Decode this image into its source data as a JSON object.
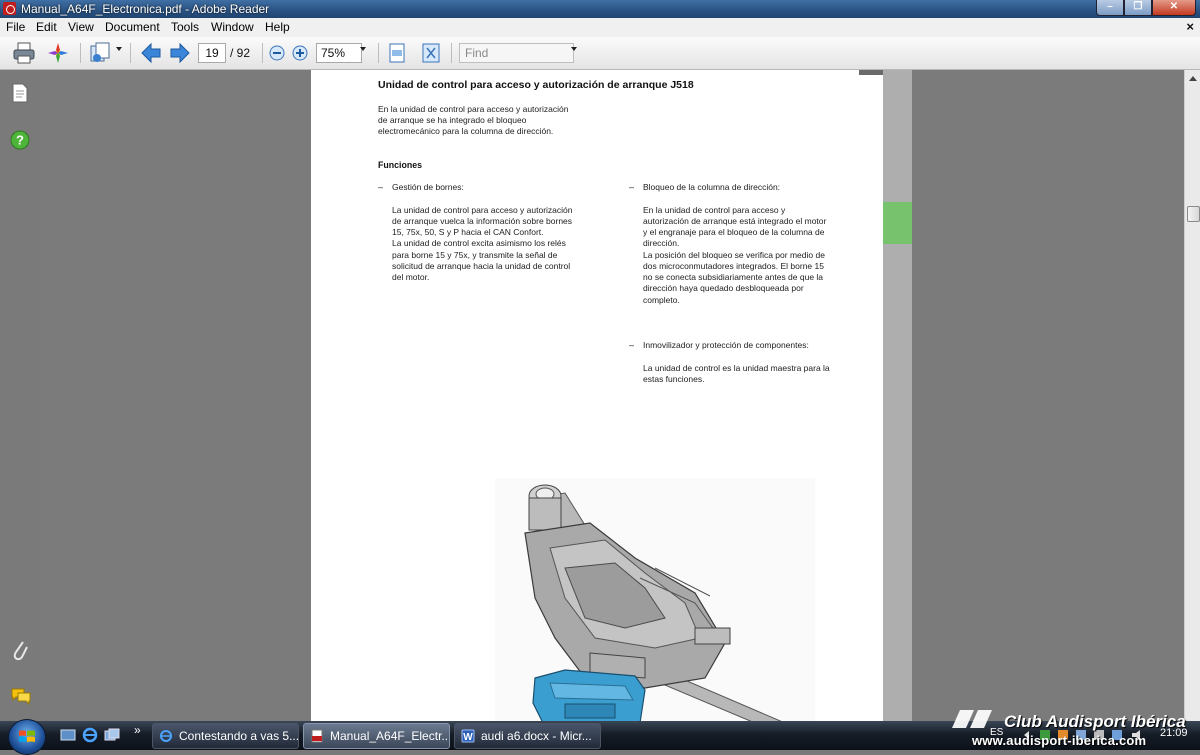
{
  "window": {
    "title": "Manual_A64F_Electronica.pdf - Adobe Reader",
    "close_doc_glyph": "×"
  },
  "menu": [
    "File",
    "Edit",
    "View",
    "Document",
    "Tools",
    "Window",
    "Help"
  ],
  "toolbar": {
    "current_page": "19",
    "total_pages": "/ 92",
    "zoom": "75%",
    "find_placeholder": "Find"
  },
  "document": {
    "heading": "Unidad de control para acceso y autorización de arranque J518",
    "intro": [
      "En la unidad de control para acceso y autorización",
      "de arranque se ha integrado el bloqueo",
      "electromecánico para la columna de dirección."
    ],
    "funciones_title": "Funciones",
    "dash": "–",
    "left_item_title": "Gestión de bornes:",
    "left_item_body": [
      "La unidad de control para acceso y autorización",
      "de arranque vuelca la información sobre bornes",
      "15, 75x, 50, S y P hacia el CAN Confort.",
      "La unidad de control excita asimismo los relés",
      "para borne 15 y 75x, y transmite la señal de",
      "solicitud de arranque hacia la unidad de control",
      "del motor."
    ],
    "right_item1_title": "Bloqueo de la columna de dirección:",
    "right_item1_body": [
      "En la unidad de control para acceso y",
      "autorización de arranque está integrado el motor",
      "y el engranaje para el bloqueo de la columna de",
      "dirección.",
      "La posición del bloqueo se verifica por medio de",
      "dos microconmutadores integrados. El borne 15",
      "no se conecta subsidiariamente antes de que la",
      "dirección haya quedado desbloqueada por",
      "completo."
    ],
    "right_item2_title": "Inmovilizador y protección de componentes:",
    "right_item2_body": [
      "La unidad de control es la unidad maestra para la",
      "estas funciones."
    ]
  },
  "taskbar": {
    "chevron": "»",
    "tasks": [
      {
        "label": "Contestando a vas 5..."
      },
      {
        "label": "Manual_A64F_Electr..."
      },
      {
        "label": "audi a6.docx - Micr..."
      }
    ],
    "language": "ES",
    "clock": "21:09"
  },
  "watermark": {
    "line1": "Club Audisport Ibérica",
    "line2": "www.audisport-iberica.com"
  },
  "colors": {
    "green_marker": "#76c26d",
    "title_bar": "#2a5283",
    "module_blue": "#3a9fd0"
  }
}
